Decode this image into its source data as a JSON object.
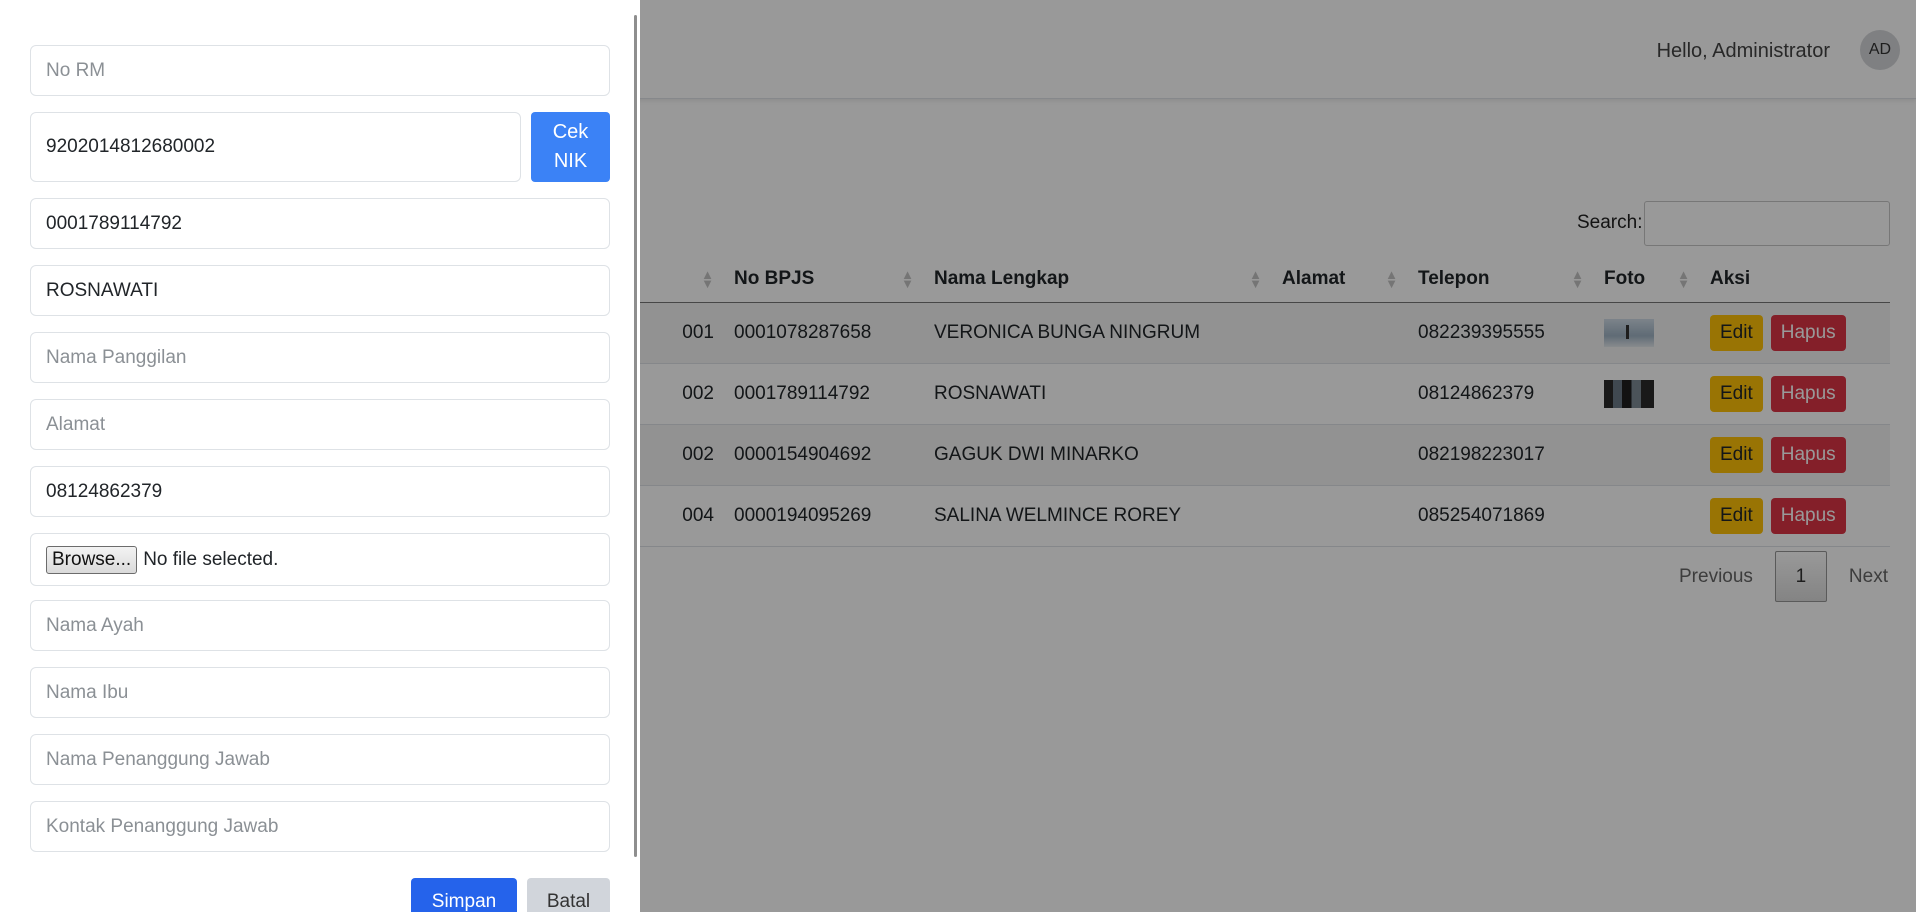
{
  "header": {
    "greeting": "Hello, Administrator",
    "avatar_initials": "AD"
  },
  "table": {
    "search_label": "Search:",
    "search_value": "",
    "columns": [
      "No BPJS",
      "Nama Lengkap",
      "Alamat",
      "Telepon",
      "Foto",
      "Aksi"
    ],
    "rows": [
      {
        "id_tail": "001",
        "bpjs": "0001078287658",
        "name": "VERONICA BUNGA NINGRUM",
        "alamat": "",
        "telepon": "082239395555",
        "edit": "Edit",
        "hapus": "Hapus"
      },
      {
        "id_tail": "002",
        "bpjs": "0001789114792",
        "name": "ROSNAWATI",
        "alamat": "",
        "telepon": "08124862379",
        "edit": "Edit",
        "hapus": "Hapus"
      },
      {
        "id_tail": "002",
        "bpjs": "0000154904692",
        "name": "GAGUK DWI MINARKO",
        "alamat": "",
        "telepon": "082198223017",
        "edit": "Edit",
        "hapus": "Hapus"
      },
      {
        "id_tail": "004",
        "bpjs": "0000194095269",
        "name": "SALINA WELMINCE ROREY",
        "alamat": "",
        "telepon": "085254071869",
        "edit": "Edit",
        "hapus": "Hapus"
      }
    ],
    "pagination": {
      "previous": "Previous",
      "current": "1",
      "next": "Next"
    }
  },
  "form": {
    "no_rm_placeholder": "No RM",
    "nik_value": "9202014812680002",
    "cek_nik_label_1": "Cek",
    "cek_nik_label_2": "NIK",
    "bpjs_value": "0001789114792",
    "nama_lengkap_value": "ROSNAWATI",
    "nama_panggilan_placeholder": "Nama Panggilan",
    "alamat_placeholder": "Alamat",
    "telepon_value": "08124862379",
    "browse_label": "Browse...",
    "file_status": "No file selected.",
    "nama_ayah_placeholder": "Nama Ayah",
    "nama_ibu_placeholder": "Nama Ibu",
    "penanggung_jawab_placeholder": "Nama Penanggung Jawab",
    "kontak_penanggung_placeholder": "Kontak Penanggung Jawab",
    "simpan_label": "Simpan",
    "batal_label": "Batal"
  }
}
